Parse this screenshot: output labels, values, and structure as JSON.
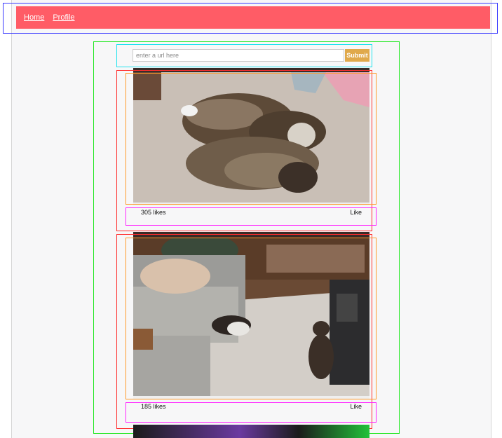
{
  "nav": {
    "links": [
      {
        "label": "Home"
      },
      {
        "label": "Profile"
      }
    ]
  },
  "upload": {
    "placeholder": "enter a url here",
    "submit_label": "Submit"
  },
  "posts": [
    {
      "likes": "305 likes",
      "like_label": "Like"
    },
    {
      "likes": "185 likes",
      "like_label": "Like"
    }
  ],
  "colors": {
    "navbar": "#ff5c66",
    "submit": "#e0a94a",
    "outline_nav": "#3b3bff",
    "outline_feed": "#25e825",
    "outline_form": "#22e3ee",
    "outline_post": "#ff2d2d",
    "outline_image": "#ff9a2a",
    "outline_meta": "#ff22ff"
  }
}
